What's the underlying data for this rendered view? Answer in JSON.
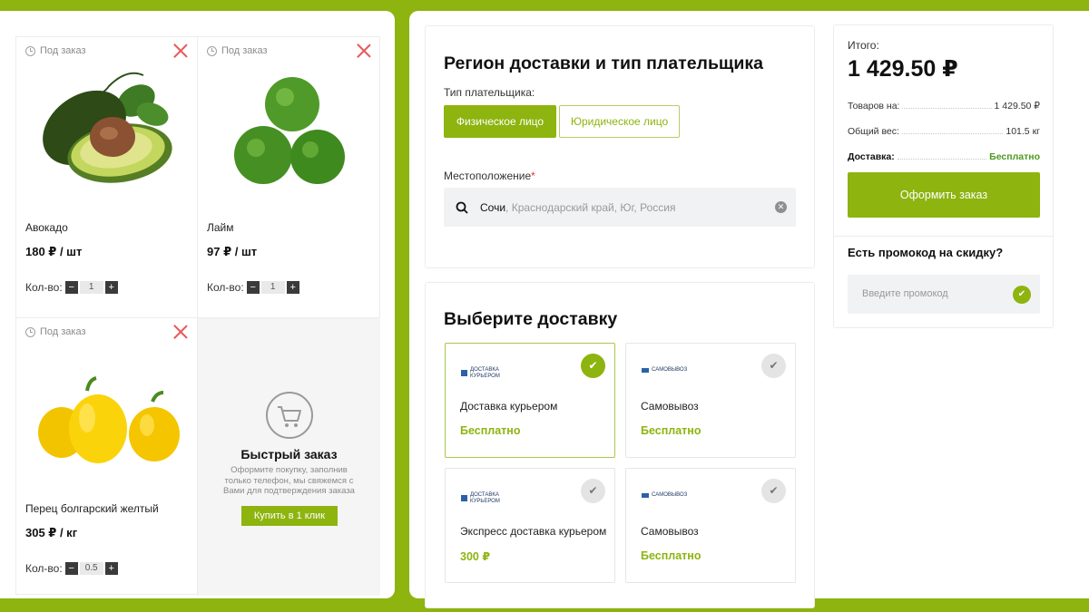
{
  "cart": {
    "items": [
      {
        "tag": "Под заказ",
        "name": "Авокадо",
        "price": "180 ₽ / шт",
        "qty_label": "Кол-во:",
        "qty": "1"
      },
      {
        "tag": "Под заказ",
        "name": "Лайм",
        "price": "97 ₽ / шт",
        "qty_label": "Кол-во:",
        "qty": "1"
      },
      {
        "tag": "Под заказ",
        "name": "Перец болгарский желтый",
        "price": "305 ₽ / кг",
        "qty_label": "Кол-во:",
        "qty": "0.5"
      }
    ],
    "qty_minus": "−",
    "qty_plus": "+",
    "quick_order": {
      "title": "Быстрый заказ",
      "text": "Оформите покупку, заполнив только телефон, мы свяжемся с Вами для подтверждения заказа",
      "button": "Купить в 1 клик"
    }
  },
  "region": {
    "title": "Регион доставки и тип плательщика",
    "payer_label": "Тип плательщика:",
    "payer_options": [
      "Физическое лицо",
      "Юридическое лицо"
    ],
    "location_label": "Местоположение",
    "required_mark": "*",
    "location_city": "Сочи",
    "location_rest": ", Краснодарский край, Юг, Россия"
  },
  "delivery": {
    "title": "Выберите доставку",
    "check_glyph": "✔",
    "options": [
      {
        "logo": "ДОСТАВКА КУРЬЕРОМ",
        "logo_line1": "ДОСТАВКА",
        "logo_line2": "КУРЬЕРОМ",
        "name": "Доставка курьером",
        "price": "Бесплатно",
        "selected": true
      },
      {
        "logo": "САМОВЫВОЗ",
        "name": "Самовывоз",
        "price": "Бесплатно",
        "selected": false
      },
      {
        "logo": "ДОСТАВКА КУРЬЕРОМ",
        "logo_line1": "ДОСТАВКА",
        "logo_line2": "КУРЬЕРОМ",
        "name": "Экспресс доставка курьером",
        "price": "300 ₽",
        "selected": false
      },
      {
        "logo": "САМОВЫВОЗ",
        "name": "Самовывоз",
        "price": "Бесплатно",
        "selected": false
      }
    ]
  },
  "summary": {
    "total_label": "Итого:",
    "total": "1 429.50 ₽",
    "rows": [
      {
        "label": "Товаров на:",
        "value": "1 429.50 ₽"
      },
      {
        "label": "Общий вес:",
        "value": "101.5 кг"
      },
      {
        "label": "Доставка:",
        "value": "Бесплатно"
      }
    ],
    "checkout": "Оформить заказ",
    "promo_title": "Есть промокод на скидку?",
    "promo_placeholder": "Введите промокод"
  },
  "colors": {
    "accent": "#8db40f",
    "remove": "#e85a5a",
    "free_delivery": "#4c9a21"
  },
  "icons": [
    "clock-icon",
    "close-icon",
    "search-icon",
    "clear-icon",
    "cart-icon",
    "check-icon",
    "box-icon",
    "truck-icon"
  ]
}
